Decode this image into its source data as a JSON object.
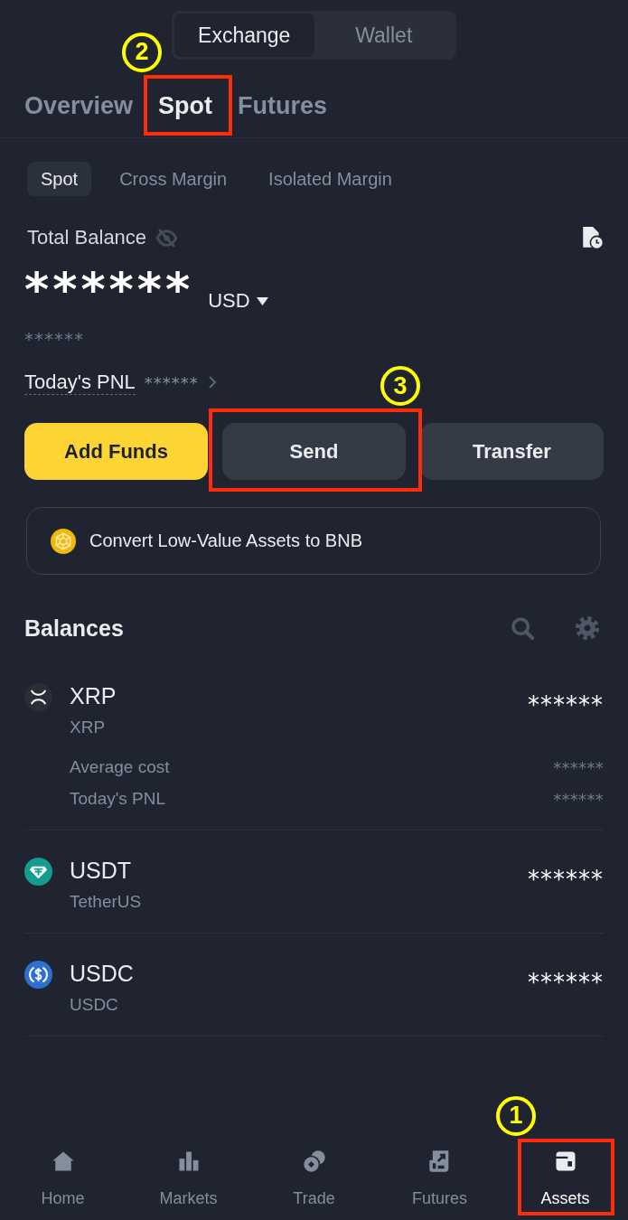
{
  "segment_tabs": [
    {
      "label": "Exchange",
      "selected": true
    },
    {
      "label": "Wallet",
      "selected": false
    }
  ],
  "tabs": [
    {
      "label": "Overview",
      "selected": false
    },
    {
      "label": "Spot",
      "selected": true,
      "annotation": {
        "number": "2"
      }
    },
    {
      "label": "Futures",
      "selected": false
    }
  ],
  "sub_tabs": [
    {
      "label": "Spot",
      "selected": true
    },
    {
      "label": "Cross Margin",
      "selected": false
    },
    {
      "label": "Isolated Margin",
      "selected": false
    }
  ],
  "total_balance": {
    "label": "Total Balance",
    "amount": "******",
    "currency": "USD",
    "converted": "******",
    "pnl_label": "Today's PNL",
    "pnl_value": "******"
  },
  "actions": [
    {
      "label": "Add Funds",
      "kind": "primary"
    },
    {
      "label": "Send",
      "kind": "secondary",
      "annotation": {
        "number": "3"
      }
    },
    {
      "label": "Transfer",
      "kind": "secondary"
    }
  ],
  "convert_banner": {
    "text": "Convert Low-Value Assets to BNB"
  },
  "balances": {
    "title": "Balances",
    "assets": [
      {
        "kind": "xrp",
        "symbol": "XRP",
        "name": "XRP",
        "amount": "******",
        "details": [
          {
            "label": "Average cost",
            "value": "******"
          },
          {
            "label": "Today's PNL",
            "value": "******"
          }
        ]
      },
      {
        "kind": "tether",
        "symbol": "USDT",
        "name": "TetherUS",
        "amount": "******"
      },
      {
        "kind": "usdc",
        "symbol": "USDC",
        "name": "USDC",
        "amount": "******"
      }
    ]
  },
  "nav": [
    {
      "kind": "home",
      "label": "Home",
      "selected": false
    },
    {
      "kind": "markets",
      "label": "Markets",
      "selected": false
    },
    {
      "kind": "trade",
      "label": "Trade",
      "selected": false
    },
    {
      "kind": "futures",
      "label": "Futures",
      "selected": false
    },
    {
      "kind": "assets",
      "label": "Assets",
      "selected": true,
      "annotation": {
        "number": "1"
      }
    }
  ]
}
